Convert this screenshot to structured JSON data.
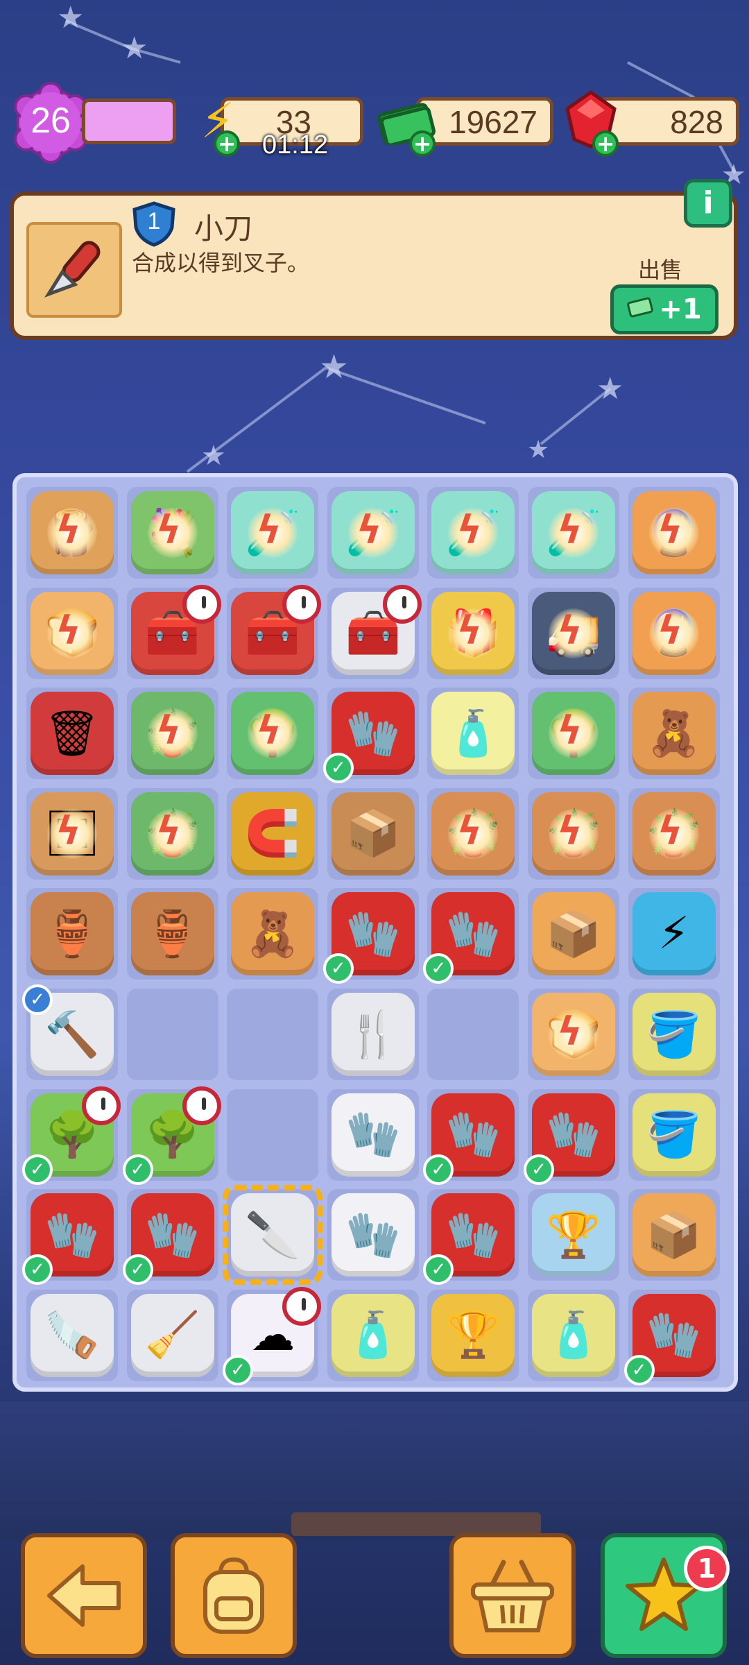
{
  "hud": {
    "level": "26",
    "energy": "33",
    "energy_timer": "01:12",
    "cash": "19627",
    "gems": "828"
  },
  "info": {
    "level_badge": "1",
    "item_name": "小刀",
    "description": "合成以得到叉子。",
    "sell_label": "出售",
    "sell_reward": "+1",
    "info_button": "i"
  },
  "bottom_bar": {
    "back_icon": "arrow-left-icon",
    "backpack_icon": "backpack-icon",
    "basket_icon": "basket-icon",
    "star_icon": "star-icon",
    "notification_count": "1"
  },
  "board": {
    "rows": 9,
    "cols": 7,
    "cells": [
      [
        {
          "item": "market-stall",
          "bolt": true
        },
        {
          "item": "gem-flower-bush",
          "bolt": true
        },
        {
          "item": "potion-bottle",
          "bolt": true
        },
        {
          "item": "potion-bottle",
          "bolt": true
        },
        {
          "item": "potion-bottle",
          "bolt": true
        },
        {
          "item": "potion-bottle",
          "bolt": true
        },
        {
          "item": "dragon-globe",
          "bolt": true
        }
      ],
      [
        {
          "item": "bread-crate",
          "bolt": true
        },
        {
          "item": "red-toolbox",
          "timer": true
        },
        {
          "item": "red-toolbox",
          "timer": true
        },
        {
          "item": "white-toolbox",
          "timer": true
        },
        {
          "item": "gift-box",
          "bolt": true
        },
        {
          "item": "truck",
          "bolt": true
        },
        {
          "item": "dragon-globe",
          "bolt": true
        }
      ],
      [
        {
          "item": "red-bin"
        },
        {
          "item": "plant-stand",
          "bolt": true
        },
        {
          "item": "tree-globe",
          "bolt": true
        },
        {
          "item": "red-glove",
          "check": true
        },
        {
          "item": "lotion-bottle"
        },
        {
          "item": "tree-globe",
          "bolt": true
        },
        {
          "item": "teddy-bear-honey"
        }
      ],
      [
        {
          "item": "picture-frame",
          "bolt": true
        },
        {
          "item": "plant-stand",
          "bolt": true
        },
        {
          "item": "horseshoe"
        },
        {
          "item": "wooden-crates"
        },
        {
          "item": "flower-pot",
          "bolt": true
        },
        {
          "item": "flower-pot",
          "bolt": true
        },
        {
          "item": "flower-pot",
          "bolt": true
        }
      ],
      [
        {
          "item": "clay-pot"
        },
        {
          "item": "broken-pot"
        },
        {
          "item": "teddy-bear"
        },
        {
          "item": "red-glove",
          "check": true
        },
        {
          "item": "red-glove",
          "check": true
        },
        {
          "item": "parcel"
        },
        {
          "item": "energy-orb"
        }
      ],
      [
        {
          "item": "hammer",
          "check_blue": true
        },
        {
          "item": "empty"
        },
        {
          "item": "empty"
        },
        {
          "item": "garden-fork"
        },
        {
          "item": "empty"
        },
        {
          "item": "bread-crate",
          "bolt": true
        },
        {
          "item": "bucket-small"
        }
      ],
      [
        {
          "item": "potted-tree",
          "check": true,
          "timer": true
        },
        {
          "item": "potted-tree",
          "check": true,
          "timer": true
        },
        {
          "item": "empty"
        },
        {
          "item": "white-glove"
        },
        {
          "item": "red-glove",
          "check": true
        },
        {
          "item": "red-glove",
          "check": true
        },
        {
          "item": "bucket"
        }
      ],
      [
        {
          "item": "red-glove",
          "check": true
        },
        {
          "item": "red-glove",
          "check": true
        },
        {
          "item": "trowel",
          "selected": true
        },
        {
          "item": "white-glove-pair"
        },
        {
          "item": "red-glove",
          "check": true
        },
        {
          "item": "crystal-trophy"
        },
        {
          "item": "parcel-stack"
        }
      ],
      [
        {
          "item": "saw"
        },
        {
          "item": "rake"
        },
        {
          "item": "cotton-flowers",
          "check": true,
          "timer": true
        },
        {
          "item": "soap-bottle"
        },
        {
          "item": "star-trophy"
        },
        {
          "item": "spray-bottle"
        },
        {
          "item": "red-glove",
          "check": true
        }
      ]
    ]
  }
}
